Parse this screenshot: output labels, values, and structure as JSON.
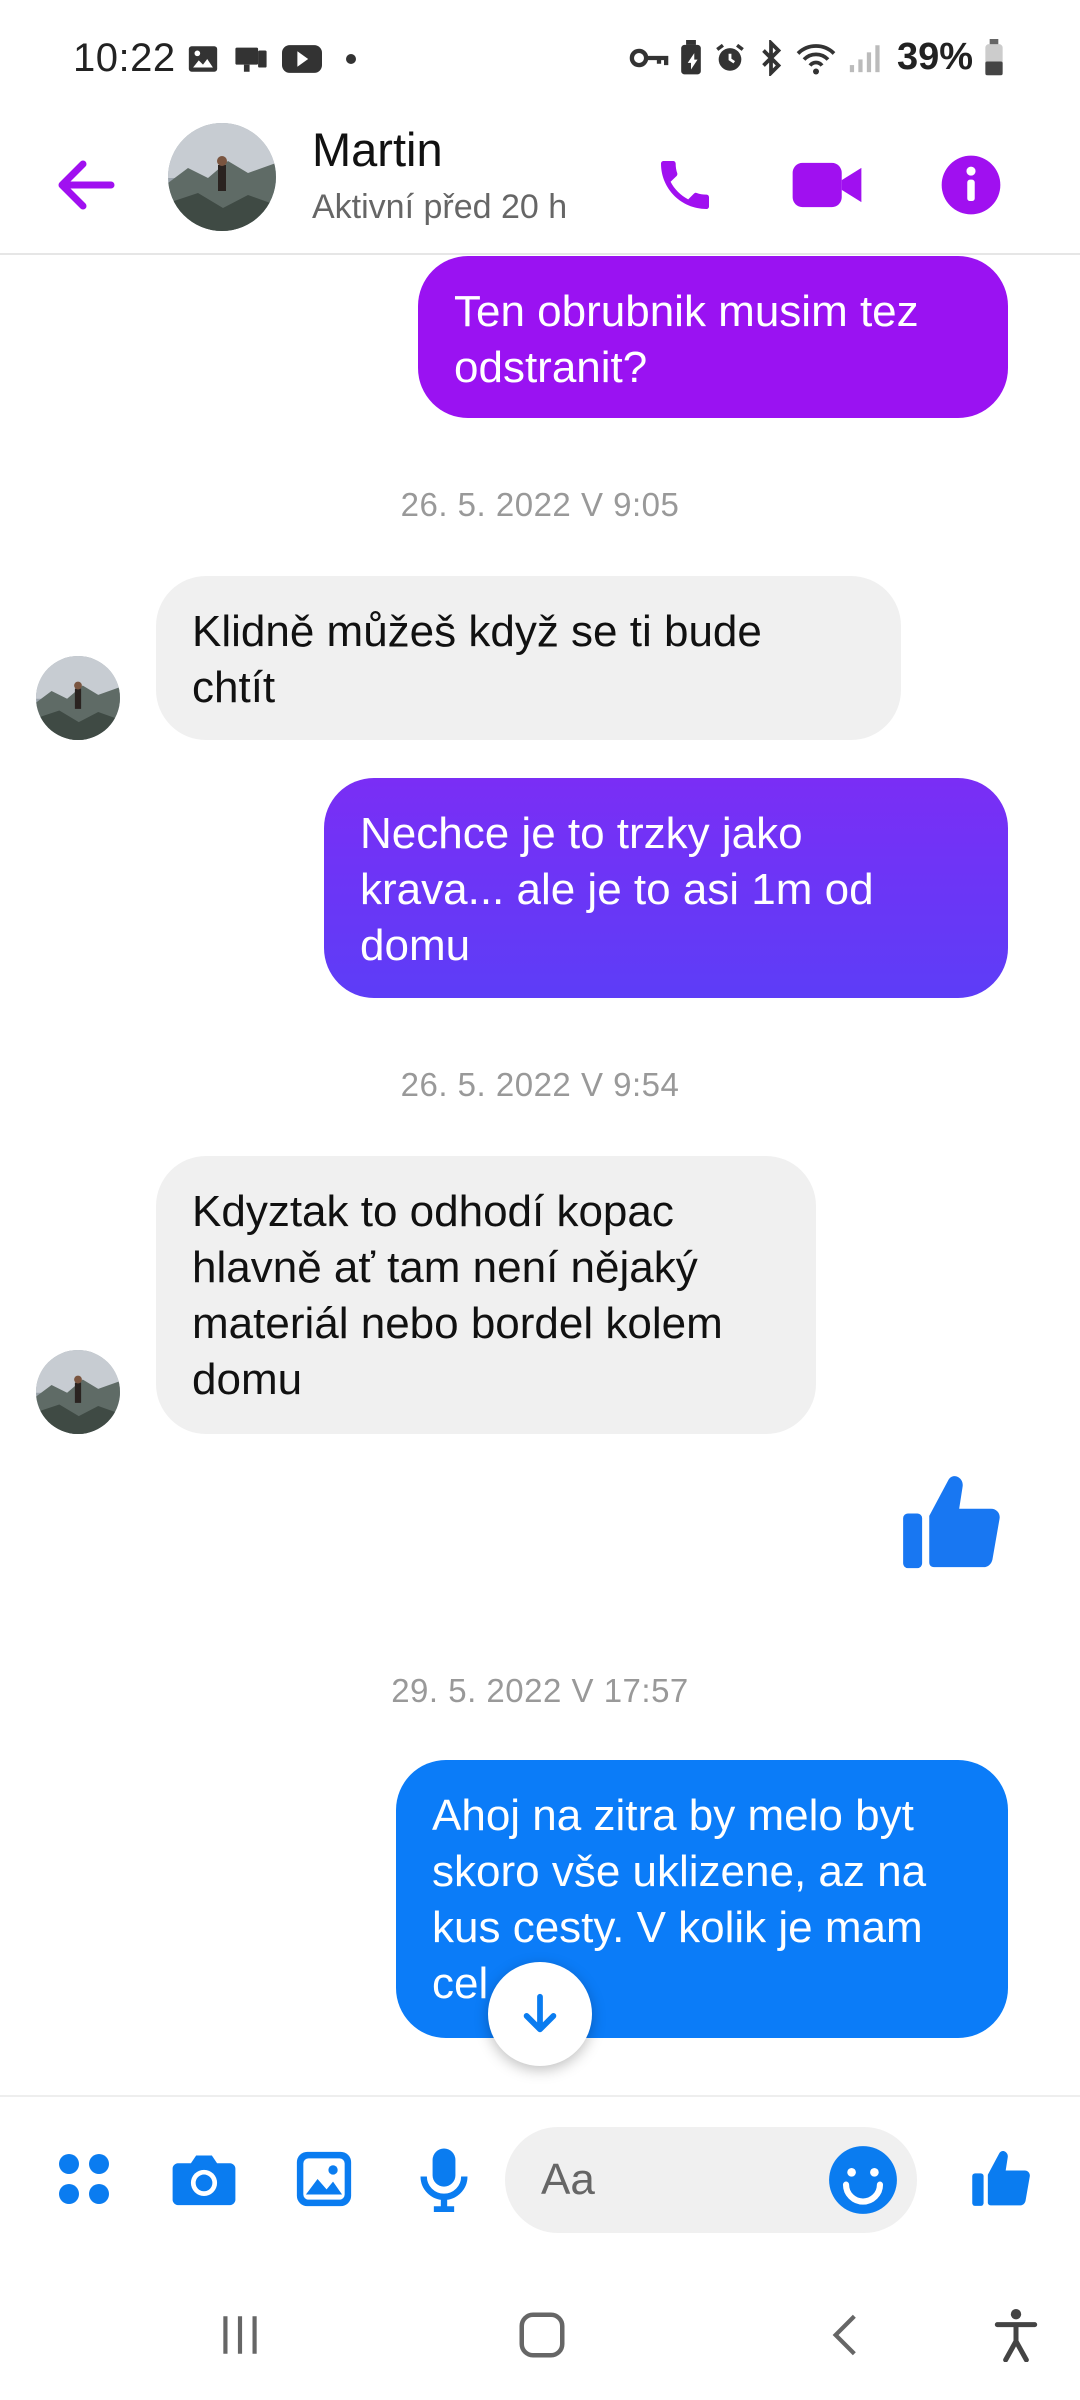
{
  "status_bar": {
    "time": "10:22",
    "battery": "39%"
  },
  "header": {
    "contact_name": "Martin",
    "contact_status": "Aktivní před 20 h"
  },
  "messages": {
    "m1": "Ten obrubnik musim tez\nodstranit?",
    "ts1": "26. 5. 2022 V 9:05",
    "m2": "Klidně můžeš když se ti bude\nchtít",
    "m3": "Nechce je to trzky jako\nkrava... ale je to asi 1m od\ndomu",
    "ts2": "26. 5. 2022 V 9:54",
    "m4": "Kdyztak to odhodí kopac\nhlavně ať tam není nějaký\nmateriál nebo bordel kolem\ndomu",
    "ts3": "29. 5. 2022 V 17:57",
    "m5": "Ahoj na zitra by melo byt\nskoro vše uklizene, az na\nkus cesty. V kolik je mam\ncel"
  },
  "composer": {
    "placeholder": "Aa"
  },
  "colors": {
    "accent_purple": "#a010f0",
    "bubble_purple": "#9a12f2",
    "bubble_violet": "#6a35f5",
    "bubble_blue": "#0b7cf8",
    "like_blue": "#1877f2",
    "composer_blue": "#0a7cf0"
  },
  "icons": {
    "back": "arrow-left-icon",
    "call": "phone-icon",
    "video": "video-camera-icon",
    "info": "info-icon",
    "like": "thumbs-up-icon",
    "scroll": "arrow-down-icon"
  }
}
